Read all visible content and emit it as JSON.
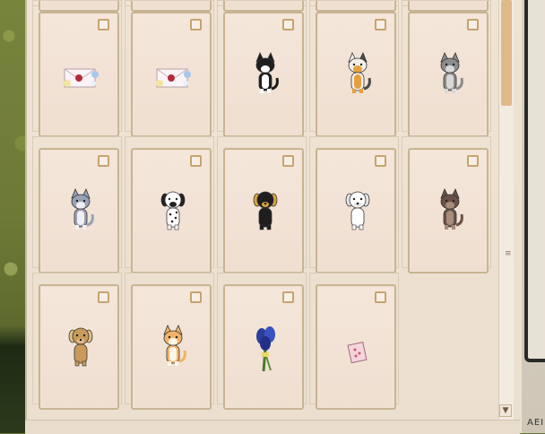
{
  "inventory": {
    "items": [
      {
        "icon": "letter-icon",
        "row": 0,
        "col": 0
      },
      {
        "icon": "letter-icon",
        "row": 0,
        "col": 1
      },
      {
        "icon": "black-white-cat-icon",
        "row": 0,
        "col": 2
      },
      {
        "icon": "calico-cat-icon",
        "row": 0,
        "col": 3
      },
      {
        "icon": "tabby-cat-icon",
        "row": 0,
        "col": 4
      },
      {
        "icon": "gray-white-cat-icon",
        "row": 1,
        "col": 0
      },
      {
        "icon": "dalmatian-dog-icon",
        "row": 1,
        "col": 1
      },
      {
        "icon": "black-tan-dog-icon",
        "row": 1,
        "col": 2
      },
      {
        "icon": "white-poodle-icon",
        "row": 1,
        "col": 3
      },
      {
        "icon": "brown-cat-icon",
        "row": 1,
        "col": 4
      },
      {
        "icon": "tan-dog-icon",
        "row": 2,
        "col": 0
      },
      {
        "icon": "orange-cat-icon",
        "row": 2,
        "col": 1
      },
      {
        "icon": "blue-flower-bouquet-icon",
        "row": 2,
        "col": 2
      },
      {
        "icon": "pink-card-icon",
        "row": 2,
        "col": 3
      }
    ]
  },
  "scrollbar": {
    "grip_glyph": "≡",
    "down_glyph": "▼"
  },
  "side_label": "AEI"
}
